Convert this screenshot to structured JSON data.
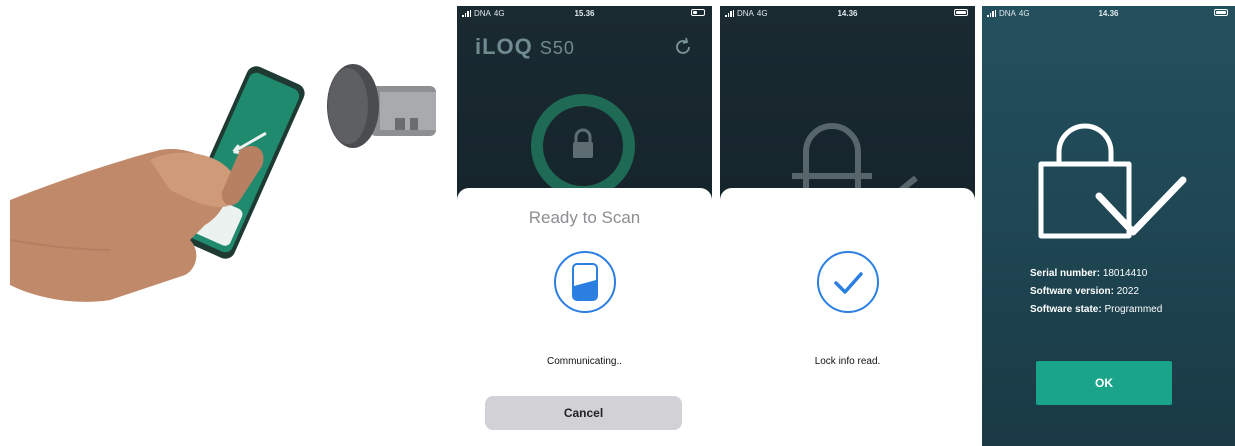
{
  "screens": [
    {
      "status": {
        "carrier": "DNA",
        "network": "4G",
        "time": "15.36"
      },
      "brand": {
        "logo": "iLOQ",
        "model": "S50"
      },
      "sheet": {
        "title": "Ready to Scan",
        "message": "Communicating..",
        "cancel_label": "Cancel"
      },
      "icons": [
        "refresh-icon",
        "lock-icon",
        "phone-icon"
      ]
    },
    {
      "status": {
        "carrier": "DNA",
        "network": "4G",
        "time": "14.36"
      },
      "sheet": {
        "message": "Lock info read."
      },
      "icons": [
        "lock-icon",
        "checkmark-icon"
      ]
    },
    {
      "status": {
        "carrier": "DNA",
        "network": "4G",
        "time": "14.36"
      },
      "info": [
        {
          "label": "Serial number:",
          "value": "18014410"
        },
        {
          "label": "Software version:",
          "value": "2022"
        },
        {
          "label": "Software state:",
          "value": "Programmed"
        }
      ],
      "ok_label": "OK",
      "icons": [
        "lock-check-icon"
      ]
    }
  ],
  "colors": {
    "accent_blue": "#2b7fe0",
    "ok_green": "#1aa489",
    "app_dark": "#15242b",
    "app_teal": "#1d4451"
  }
}
